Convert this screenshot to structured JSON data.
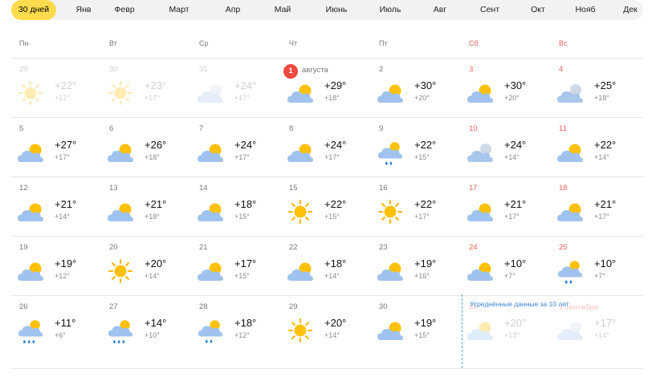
{
  "tabs": [
    {
      "label": "30 дней",
      "active": true
    },
    {
      "label": "Янв"
    },
    {
      "label": "Февр"
    },
    {
      "label": "Март"
    },
    {
      "label": "Апр"
    },
    {
      "label": "Май"
    },
    {
      "label": "Июнь"
    },
    {
      "label": "Июль"
    },
    {
      "label": "Авг"
    },
    {
      "label": "Сент"
    },
    {
      "label": "Окт"
    },
    {
      "label": "Нояб"
    },
    {
      "label": "Дек"
    }
  ],
  "weekdays": [
    {
      "label": "Пн"
    },
    {
      "label": "Вт"
    },
    {
      "label": "Ср"
    },
    {
      "label": "Чт"
    },
    {
      "label": "Пт"
    },
    {
      "label": "Сб",
      "weekend": true
    },
    {
      "label": "Вс",
      "weekend": true
    }
  ],
  "averaged_note": "Усреднённые данные за 10 лет",
  "colors": {
    "accent": "#ffdb4d",
    "weekend": "#f0625a",
    "today": "#f0483e",
    "average_note": "#3a86d6"
  },
  "weeks": [
    [
      {
        "day": "29",
        "hi": "+22°",
        "lo": "+17°",
        "icon": "sun-icon",
        "dim": true
      },
      {
        "day": "30",
        "hi": "+23°",
        "lo": "+17°",
        "icon": "sun-icon",
        "dim": true
      },
      {
        "day": "31",
        "hi": "+24°",
        "lo": "+17°",
        "icon": "cloudy-icon",
        "dim": true
      },
      {
        "day": "1",
        "month": "августа",
        "today": true,
        "hi": "+29°",
        "lo": "+18°",
        "icon": "partly-cloudy-icon"
      },
      {
        "day": "2",
        "hi": "+30°",
        "lo": "+20°",
        "icon": "partly-cloudy-icon"
      },
      {
        "day": "3",
        "hi": "+30°",
        "lo": "+20°",
        "icon": "partly-cloudy-icon",
        "weekend": true
      },
      {
        "day": "4",
        "hi": "+25°",
        "lo": "+18°",
        "icon": "cloudy-icon",
        "weekend": true
      }
    ],
    [
      {
        "day": "5",
        "hi": "+27°",
        "lo": "+17°",
        "icon": "partly-cloudy-icon"
      },
      {
        "day": "6",
        "hi": "+26°",
        "lo": "+18°",
        "icon": "partly-cloudy-icon"
      },
      {
        "day": "7",
        "hi": "+24°",
        "lo": "+17°",
        "icon": "partly-cloudy-icon"
      },
      {
        "day": "8",
        "hi": "+24°",
        "lo": "+17°",
        "icon": "partly-cloudy-icon"
      },
      {
        "day": "9",
        "hi": "+22°",
        "lo": "+15°",
        "icon": "rain-icon"
      },
      {
        "day": "10",
        "hi": "+24°",
        "lo": "+14°",
        "icon": "cloudy-icon",
        "weekend": true
      },
      {
        "day": "11",
        "hi": "+22°",
        "lo": "+14°",
        "icon": "partly-cloudy-icon",
        "weekend": true
      }
    ],
    [
      {
        "day": "12",
        "hi": "+21°",
        "lo": "+14°",
        "icon": "partly-cloudy-icon"
      },
      {
        "day": "13",
        "hi": "+21°",
        "lo": "+18°",
        "icon": "partly-cloudy-icon"
      },
      {
        "day": "14",
        "hi": "+18°",
        "lo": "+15°",
        "icon": "partly-cloudy-icon"
      },
      {
        "day": "15",
        "hi": "+22°",
        "lo": "+15°",
        "icon": "sun-icon"
      },
      {
        "day": "16",
        "hi": "+22°",
        "lo": "+17°",
        "icon": "sun-icon"
      },
      {
        "day": "17",
        "hi": "+21°",
        "lo": "+17°",
        "icon": "partly-cloudy-icon",
        "weekend": true
      },
      {
        "day": "18",
        "hi": "+21°",
        "lo": "+17°",
        "icon": "partly-cloudy-icon",
        "weekend": true
      }
    ],
    [
      {
        "day": "19",
        "hi": "+19°",
        "lo": "+12°",
        "icon": "partly-cloudy-icon"
      },
      {
        "day": "20",
        "hi": "+20°",
        "lo": "+14°",
        "icon": "sun-icon"
      },
      {
        "day": "21",
        "hi": "+17°",
        "lo": "+15°",
        "icon": "partly-cloudy-icon"
      },
      {
        "day": "22",
        "hi": "+18°",
        "lo": "+14°",
        "icon": "partly-cloudy-icon"
      },
      {
        "day": "23",
        "hi": "+19°",
        "lo": "+16°",
        "icon": "partly-cloudy-icon"
      },
      {
        "day": "24",
        "hi": "+10°",
        "lo": "+7°",
        "icon": "partly-cloudy-icon",
        "weekend": true
      },
      {
        "day": "25",
        "hi": "+10°",
        "lo": "+7°",
        "icon": "rain-icon",
        "weekend": true
      }
    ],
    [
      {
        "day": "26",
        "hi": "+11°",
        "lo": "+6°",
        "icon": "heavy-rain-icon"
      },
      {
        "day": "27",
        "hi": "+14°",
        "lo": "+10°",
        "icon": "heavy-rain-icon"
      },
      {
        "day": "28",
        "hi": "+18°",
        "lo": "+12°",
        "icon": "rain-icon"
      },
      {
        "day": "29",
        "hi": "+20°",
        "lo": "+14°",
        "icon": "sun-icon"
      },
      {
        "day": "30",
        "hi": "+19°",
        "lo": "+15°",
        "icon": "partly-cloudy-icon"
      },
      {
        "day": "31",
        "hi": "+20°",
        "lo": "+13°",
        "icon": "partly-cloudy-icon",
        "dim": true,
        "weekend": true
      },
      {
        "day": "1",
        "month": "сентября",
        "hi": "+17°",
        "lo": "+14°",
        "icon": "cloudy-icon",
        "dim": true,
        "weekend": true
      }
    ]
  ]
}
